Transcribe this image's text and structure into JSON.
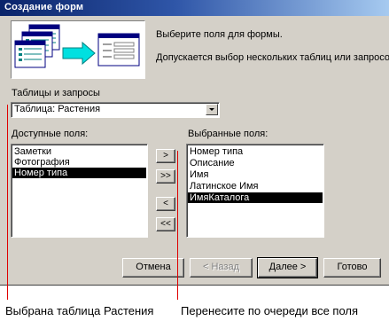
{
  "window": {
    "title": "Создание форм"
  },
  "instructions": {
    "line1": "Выберите поля для формы.",
    "line2": "Допускается выбор нескольких таблиц или запросов."
  },
  "tables_queries": {
    "label": "Таблицы и запросы",
    "selected_value": "Таблица: Растения"
  },
  "available_fields": {
    "label": "Доступные поля:",
    "items": [
      "Заметки",
      "Фотография",
      "Номер типа"
    ],
    "selected_index": 2
  },
  "selected_fields": {
    "label": "Выбранные поля:",
    "items": [
      "Номер типа",
      "Описание",
      "Имя",
      "Латинское Имя",
      "ИмяКаталога"
    ],
    "selected_index": 4
  },
  "move_buttons": {
    "add_one": ">",
    "add_all": ">>",
    "remove_one": "<",
    "remove_all": "<<"
  },
  "footer_buttons": {
    "cancel": "Отмена",
    "back": "< Назад",
    "next": "Далее >",
    "finish": "Готово"
  },
  "annotations": {
    "left": "Выбрана таблица Растения",
    "right": "Перенесите по очереди все поля"
  },
  "colors": {
    "title_start": "#0a246a",
    "title_end": "#a6caf0",
    "dialog_face": "#d4d0c8",
    "annotation_line": "#e00000",
    "arrow_fill": "#00e0e0"
  }
}
